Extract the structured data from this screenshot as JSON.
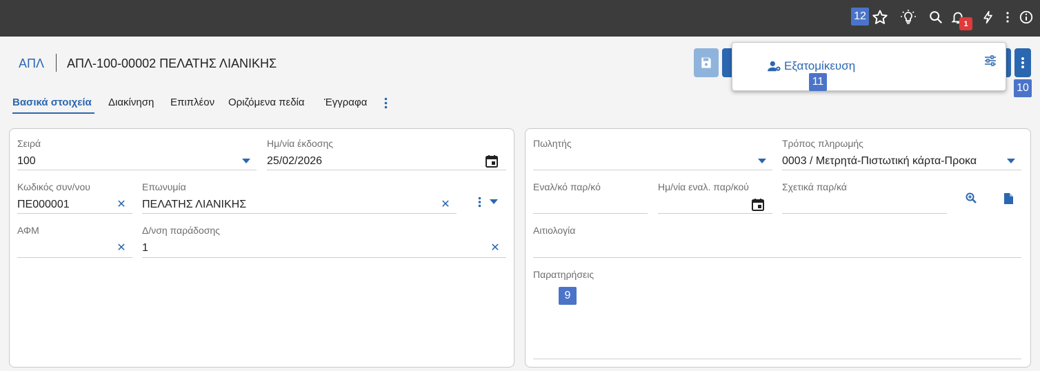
{
  "topbar": {
    "tag_12": "12",
    "notif_count": "1",
    "icons": [
      "star-icon",
      "bulb-icon",
      "search-icon",
      "bell-icon",
      "bolt-icon",
      "kebab-icon",
      "info-icon"
    ]
  },
  "header": {
    "code": "ΑΠΛ",
    "title": "ΑΠΛ-100-00002 ΠΕΛΑΤΗΣ ΛΙΑΝΙΚΗΣ"
  },
  "popover": {
    "item_label": "Εξατομίκευση",
    "tag_11": "11"
  },
  "tag_10": "10",
  "tag_9": "9",
  "tabs": [
    "Βασικά στοιχεία",
    "Διακίνηση",
    "Επιπλέον",
    "Οριζόμενα πεδία",
    "Έγγραφα"
  ],
  "left_panel": {
    "series_label": "Σειρά",
    "series_value": "100",
    "date_label": "Ημ/νία έκδοσης",
    "date_value": "25/02/2026",
    "code_label": "Κωδικός συν/νου",
    "code_value": "ΠΕ000001",
    "name_label": "Επωνυμία",
    "name_value": "ΠΕΛΑΤΗΣ ΛΙΑΝΙΚΗΣ",
    "afm_label": "ΑΦΜ",
    "afm_value": "",
    "address_label": "Δ/νση παράδοσης",
    "address_value": "1"
  },
  "right_panel": {
    "seller_label": "Πωλητής",
    "seller_value": "",
    "payment_label": "Τρόπος πληρωμής",
    "payment_value": "0003 / Μετρητά-Πιστωτική κάρτα-Προκα",
    "alt_doc_label": "Εναλ/κό παρ/κό",
    "alt_date_label": "Ημ/νία εναλ. παρ/κού",
    "related_label": "Σχετικά παρ/κά",
    "reason_label": "Αιτιολογία",
    "notes_label": "Παρατηρήσεις"
  },
  "colors": {
    "accent": "#2b67b0",
    "topbar": "#3c3c3c",
    "tag": "#4b74c9",
    "badge": "#e03a3a"
  }
}
